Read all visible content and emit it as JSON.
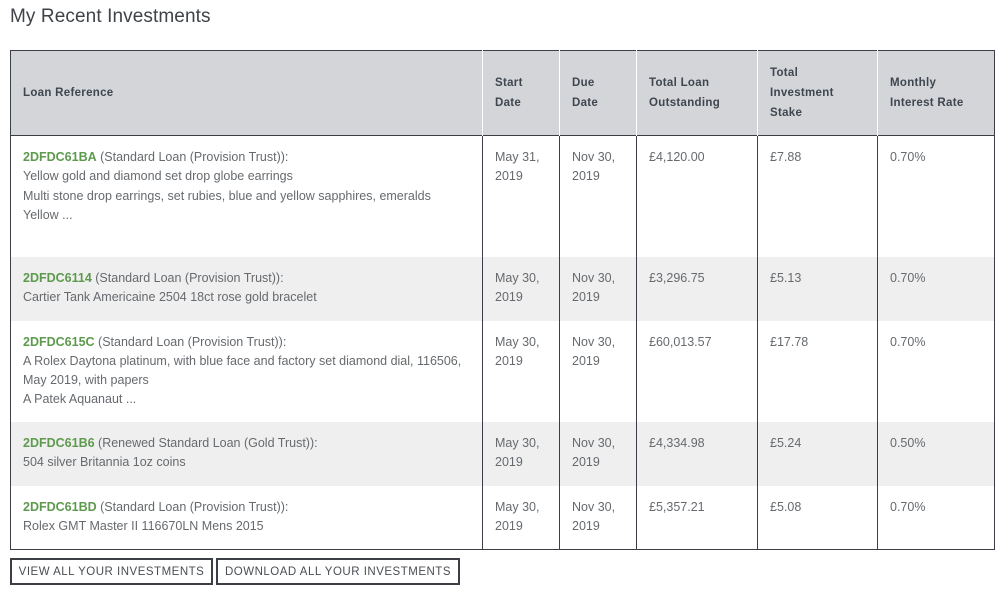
{
  "page": {
    "title": "My Recent Investments"
  },
  "table": {
    "headers": {
      "loan_reference": "Loan Reference",
      "start_date": [
        "Start",
        "Date"
      ],
      "due_date": [
        "Due",
        "Date"
      ],
      "total_loan_outstanding": [
        "Total Loan",
        "Outstanding"
      ],
      "total_investment_stake": [
        "Total",
        "Investment",
        "Stake"
      ],
      "monthly_interest_rate": [
        "Monthly",
        "Interest Rate"
      ]
    },
    "rows": [
      {
        "ref": "2DFDC61BA",
        "type": " (Standard Loan (Provision Trust)):",
        "desc": [
          "Yellow gold and diamond set drop globe earrings",
          "Multi stone drop earrings, set rubies, blue and yellow sapphires, emeralds",
          "Yellow ..."
        ],
        "start": [
          "May 31,",
          "2019"
        ],
        "due": [
          "Nov 30,",
          "2019"
        ],
        "outstanding": "£4,120.00",
        "stake": "£7.88",
        "rate": "0.70%"
      },
      {
        "ref": "2DFDC6114",
        "type": " (Standard Loan (Provision Trust)):",
        "desc": [
          "Cartier Tank Americaine 2504 18ct rose gold bracelet"
        ],
        "start": [
          "May 30,",
          "2019"
        ],
        "due": [
          "Nov 30,",
          "2019"
        ],
        "outstanding": "£3,296.75",
        "stake": "£5.13",
        "rate": "0.70%"
      },
      {
        "ref": "2DFDC615C",
        "type": " (Standard Loan (Provision Trust)):",
        "desc": [
          "A Rolex Daytona platinum, with blue face and factory set diamond dial, 116506, May 2019, with papers",
          "A Patek Aquanaut ..."
        ],
        "start": [
          "May 30,",
          "2019"
        ],
        "due": [
          "Nov 30,",
          "2019"
        ],
        "outstanding": "£60,013.57",
        "stake": "£17.78",
        "rate": "0.70%"
      },
      {
        "ref": "2DFDC61B6",
        "type": " (Renewed Standard Loan (Gold Trust)):",
        "desc": [
          "504 silver Britannia 1oz coins"
        ],
        "start": [
          "May 30,",
          "2019"
        ],
        "due": [
          "Nov 30,",
          "2019"
        ],
        "outstanding": "£4,334.98",
        "stake": "£5.24",
        "rate": "0.50%"
      },
      {
        "ref": "2DFDC61BD",
        "type": " (Standard Loan (Provision Trust)):",
        "desc": [
          "Rolex GMT Master II 116670LN Mens 2015"
        ],
        "start": [
          "May 30,",
          "2019"
        ],
        "due": [
          "Nov 30,",
          "2019"
        ],
        "outstanding": "£5,357.21",
        "stake": "£5.08",
        "rate": "0.70%"
      }
    ]
  },
  "buttons": {
    "view_all": "VIEW ALL YOUR INVESTMENTS",
    "download_all": "DOWNLOAD ALL YOUR INVESTMENTS"
  },
  "colors": {
    "loan_ref_green": "#5e9a4e",
    "header_bg": "#d3d5d8",
    "alt_row_bg": "#efefef",
    "border": "#3b3f45"
  }
}
